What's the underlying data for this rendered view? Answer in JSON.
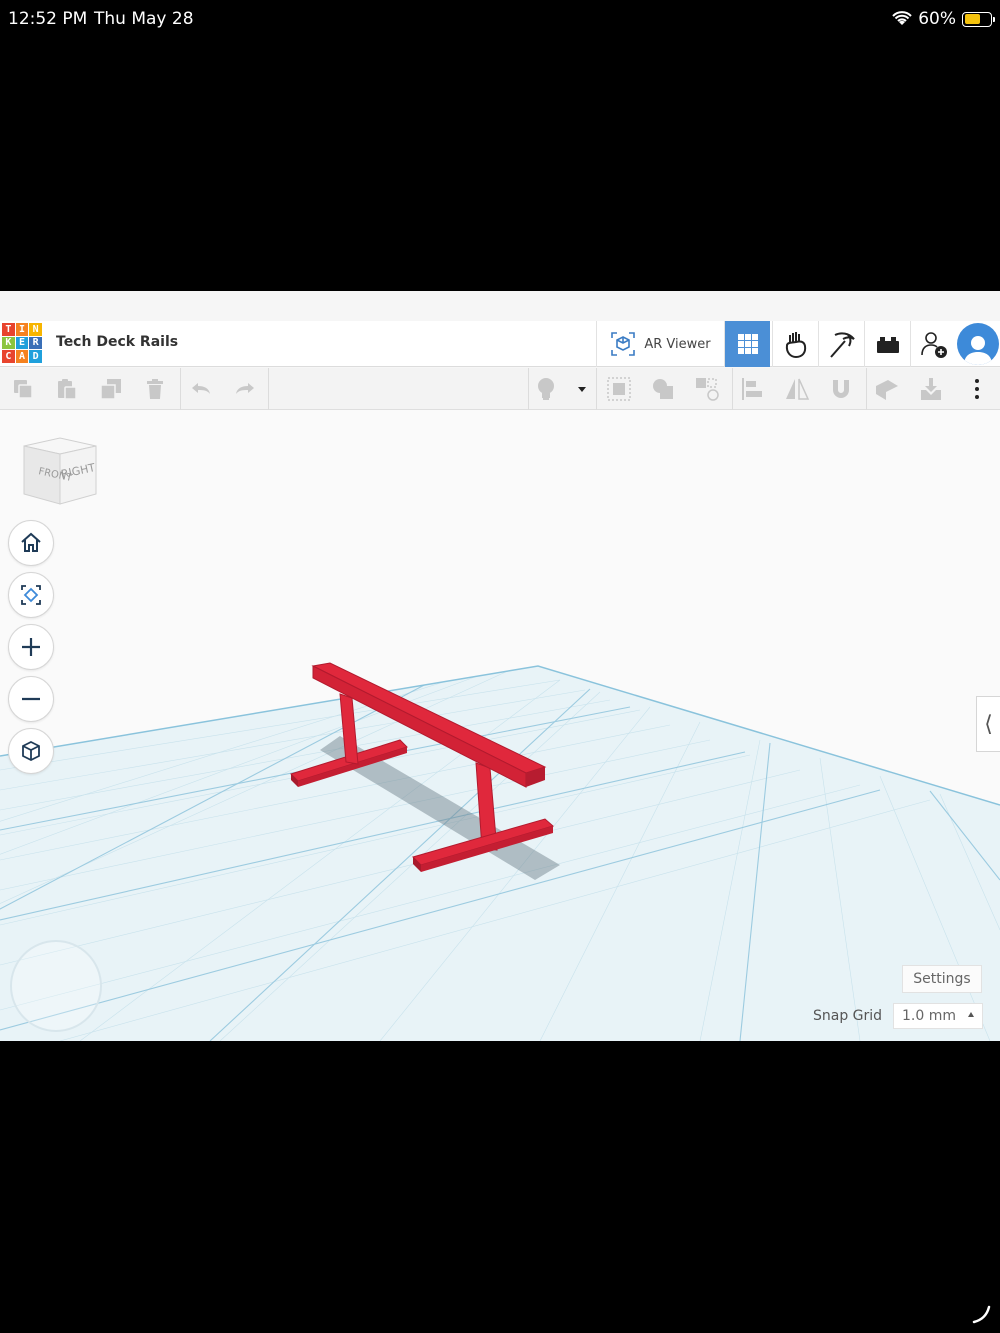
{
  "status": {
    "time": "12:52 PM",
    "date": "Thu May 28",
    "battery": "60%",
    "battery_level": 0.6
  },
  "app": {
    "logo_letters": [
      "T",
      "I",
      "N",
      "K",
      "E",
      "R",
      "C",
      "A",
      "D"
    ],
    "logo_colors": [
      "#e8442e",
      "#f58220",
      "#f7b500",
      "#8bc53f",
      "#1fa0dc",
      "#3a6fb7",
      "#e8442e",
      "#f58220",
      "#1fa0dc"
    ],
    "title": "Tech Deck Rails",
    "ar_viewer_label": "AR Viewer",
    "accent": "#4b8fd6"
  },
  "viewcube": {
    "front": "FRONT",
    "right": "RIGHT",
    "top": "TOP"
  },
  "bottom_controls": {
    "settings_label": "Settings",
    "snap_grid_label": "Snap Grid",
    "snap_grid_value": "1.0 mm"
  },
  "model": {
    "color": "#e0283c",
    "edge_color": "#b21a2e"
  }
}
